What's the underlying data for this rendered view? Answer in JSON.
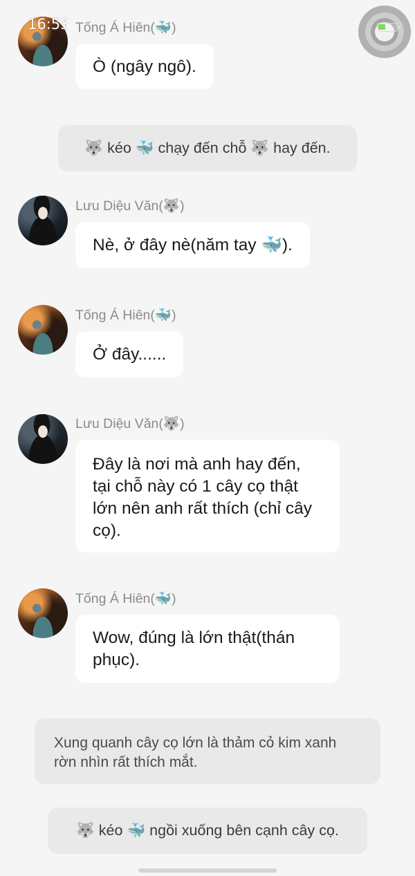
{
  "status_bar": {
    "time": "16:53",
    "battery_level": 0.4
  },
  "chars": {
    "hien": {
      "name": "Tống Á Hiên(🐳)"
    },
    "van": {
      "name": "Lưu Diệu Văn(🐺)"
    }
  },
  "messages": [
    {
      "sender": "Tống Á Hiên(🐳)",
      "text": "Ò (ngây ngô)."
    },
    {
      "narration": "🐺 kéo 🐳 chạy đến chỗ 🐺 hay đến."
    },
    {
      "sender": "Lưu Diệu Văn(🐺)",
      "text": "Nè, ở đây nè(năm tay 🐳)."
    },
    {
      "sender": "Tống Á Hiên(🐳)",
      "text": "Ở đây......"
    },
    {
      "sender": "Lưu Diệu Văn(🐺)",
      "text": "Đây là nơi mà anh hay đến, tại chỗ này có 1 cây cọ thật lớn nên anh rất thích (chỉ cây cọ)."
    },
    {
      "sender": "Tống Á Hiên(🐳)",
      "text": "Wow, đúng là lớn thật(thán phục)."
    },
    {
      "narration": "Xung quanh cây cọ lớn là thảm cỏ kim xanh rờn nhìn rất thích mắt."
    },
    {
      "narration": "🐺 kéo 🐳 ngồi xuống bên cạnh cây cọ."
    }
  ],
  "icons": {
    "assistive_touch": "assistive-touch-button",
    "battery": "battery-icon",
    "avatar_hien": "avatar-hien",
    "avatar_van": "avatar-van"
  },
  "colors": {
    "background": "#f5f5f5",
    "bubble": "#ffffff",
    "narration": "#e9e9e9",
    "sender_name": "#8a8a8a"
  }
}
